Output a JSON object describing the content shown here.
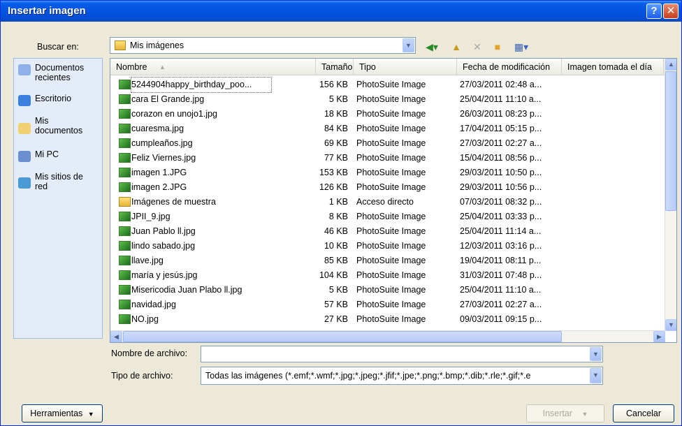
{
  "dialog": {
    "title": "Insertar imagen"
  },
  "title_buttons": {
    "help": "?",
    "close": "✕"
  },
  "look_in": {
    "label": "Buscar en:",
    "value": "Mis imágenes"
  },
  "toolbar": {
    "back_icon": "back-icon",
    "up_icon": "up-folder-icon",
    "delete_icon": "delete-icon",
    "new_folder_icon": "new-folder-icon",
    "views_icon": "views-icon"
  },
  "places": [
    {
      "name": "documentos-recientes",
      "label_line1": "Documentos",
      "label_line2": "recientes"
    },
    {
      "name": "escritorio",
      "label_line1": "Escritorio",
      "label_line2": ""
    },
    {
      "name": "mis-documentos",
      "label_line1": "Mis",
      "label_line2": "documentos"
    },
    {
      "name": "mi-pc",
      "label_line1": "Mi PC",
      "label_line2": ""
    },
    {
      "name": "mis-sitios-de-red",
      "label_line1": "Mis sitios de",
      "label_line2": "red"
    }
  ],
  "columns": {
    "name": "Nombre",
    "size": "Tamaño",
    "type": "Tipo",
    "date": "Fecha de modificación",
    "taken": "Imagen tomada el día"
  },
  "files": [
    {
      "name": "5244904happy_birthday_poo...",
      "size": "156 KB",
      "type": "PhotoSuite Image",
      "date": "27/03/2011 02:48 a..."
    },
    {
      "name": "cara El Grande.jpg",
      "size": "5 KB",
      "type": "PhotoSuite Image",
      "date": "25/04/2011 11:10 a..."
    },
    {
      "name": "corazon en unojo1.jpg",
      "size": "18 KB",
      "type": "PhotoSuite Image",
      "date": "26/03/2011 08:23 p..."
    },
    {
      "name": "cuaresma.jpg",
      "size": "84 KB",
      "type": "PhotoSuite Image",
      "date": "17/04/2011 05:15 p..."
    },
    {
      "name": "cumpleaños.jpg",
      "size": "69 KB",
      "type": "PhotoSuite Image",
      "date": "27/03/2011 02:27 a..."
    },
    {
      "name": "Feliz Viernes.jpg",
      "size": "77 KB",
      "type": "PhotoSuite Image",
      "date": "15/04/2011 08:56 p..."
    },
    {
      "name": "imagen 1.JPG",
      "size": "153 KB",
      "type": "PhotoSuite Image",
      "date": "29/03/2011 10:50 p..."
    },
    {
      "name": "imagen 2.JPG",
      "size": "126 KB",
      "type": "PhotoSuite Image",
      "date": "29/03/2011 10:56 p..."
    },
    {
      "name": "Imágenes de muestra",
      "size": "1 KB",
      "type": "Acceso directo",
      "date": "07/03/2011 08:32 p..."
    },
    {
      "name": "JPII_9.jpg",
      "size": "8 KB",
      "type": "PhotoSuite Image",
      "date": "25/04/2011 03:33 p..."
    },
    {
      "name": "Juan Pablo ll.jpg",
      "size": "46 KB",
      "type": "PhotoSuite Image",
      "date": "25/04/2011 11:14 a..."
    },
    {
      "name": "lindo sabado.jpg",
      "size": "10 KB",
      "type": "PhotoSuite Image",
      "date": "12/03/2011 03:16 p..."
    },
    {
      "name": "llave.jpg",
      "size": "85 KB",
      "type": "PhotoSuite Image",
      "date": "19/04/2011 08:11 p..."
    },
    {
      "name": "maría y jesús.jpg",
      "size": "104 KB",
      "type": "PhotoSuite Image",
      "date": "31/03/2011 07:48 p..."
    },
    {
      "name": "Misericodia Juan Plabo ll.jpg",
      "size": "5 KB",
      "type": "PhotoSuite Image",
      "date": "25/04/2011 11:10 a..."
    },
    {
      "name": "navidad.jpg",
      "size": "57 KB",
      "type": "PhotoSuite Image",
      "date": "27/03/2011 02:27 a..."
    },
    {
      "name": "NO.jpg",
      "size": "27 KB",
      "type": "PhotoSuite Image",
      "date": "09/03/2011 09:15 p..."
    }
  ],
  "filename": {
    "label": "Nombre de archivo:",
    "value": ""
  },
  "filetype": {
    "label": "Tipo de archivo:",
    "value": "Todas las imágenes (*.emf;*.wmf;*.jpg;*.jpeg;*.jfif;*.jpe;*.png;*.bmp;*.dib;*.rle;*.gif;*.e"
  },
  "buttons": {
    "tools": "Herramientas",
    "insert": "Insertar",
    "cancel": "Cancelar"
  }
}
